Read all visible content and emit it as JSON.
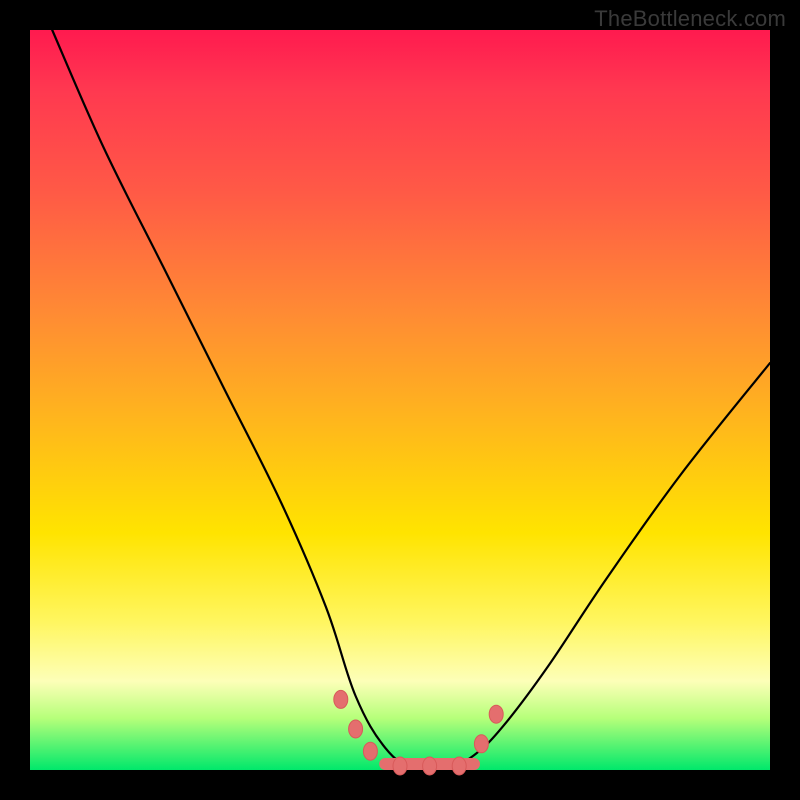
{
  "watermark": "TheBottleneck.com",
  "colors": {
    "background": "#000000",
    "gradient_top": "#ff1a4f",
    "gradient_mid": "#ffe400",
    "gradient_bottom": "#00e86b",
    "curve": "#000000",
    "marker": "#e46e6e"
  },
  "chart_data": {
    "type": "line",
    "title": "",
    "xlabel": "",
    "ylabel": "",
    "xlim": [
      0,
      100
    ],
    "ylim": [
      0,
      100
    ],
    "grid": false,
    "notes": "Bottleneck-style curve: y≈100 at x≈3, descends steeply to ~0 around x≈45–60 (flat minimum), rises again toward ~55 at x≈100. No axis ticks shown. Colored gradient encodes y (red high → green low). Pink markers cluster near the minimum.",
    "series": [
      {
        "name": "bottleneck",
        "x": [
          3,
          10,
          18,
          26,
          34,
          40,
          44,
          48,
          52,
          56,
          60,
          64,
          70,
          78,
          88,
          100
        ],
        "y": [
          100,
          84,
          68,
          52,
          36,
          22,
          10,
          3,
          0,
          0,
          2,
          6,
          14,
          26,
          40,
          55
        ]
      }
    ],
    "markers": [
      {
        "x": 42,
        "y": 9
      },
      {
        "x": 44,
        "y": 5
      },
      {
        "x": 46,
        "y": 2
      },
      {
        "x": 50,
        "y": 0
      },
      {
        "x": 54,
        "y": 0
      },
      {
        "x": 58,
        "y": 0
      },
      {
        "x": 61,
        "y": 3
      },
      {
        "x": 63,
        "y": 7
      }
    ],
    "flat_segment": {
      "x_start": 48,
      "x_end": 60,
      "y": 0
    }
  }
}
